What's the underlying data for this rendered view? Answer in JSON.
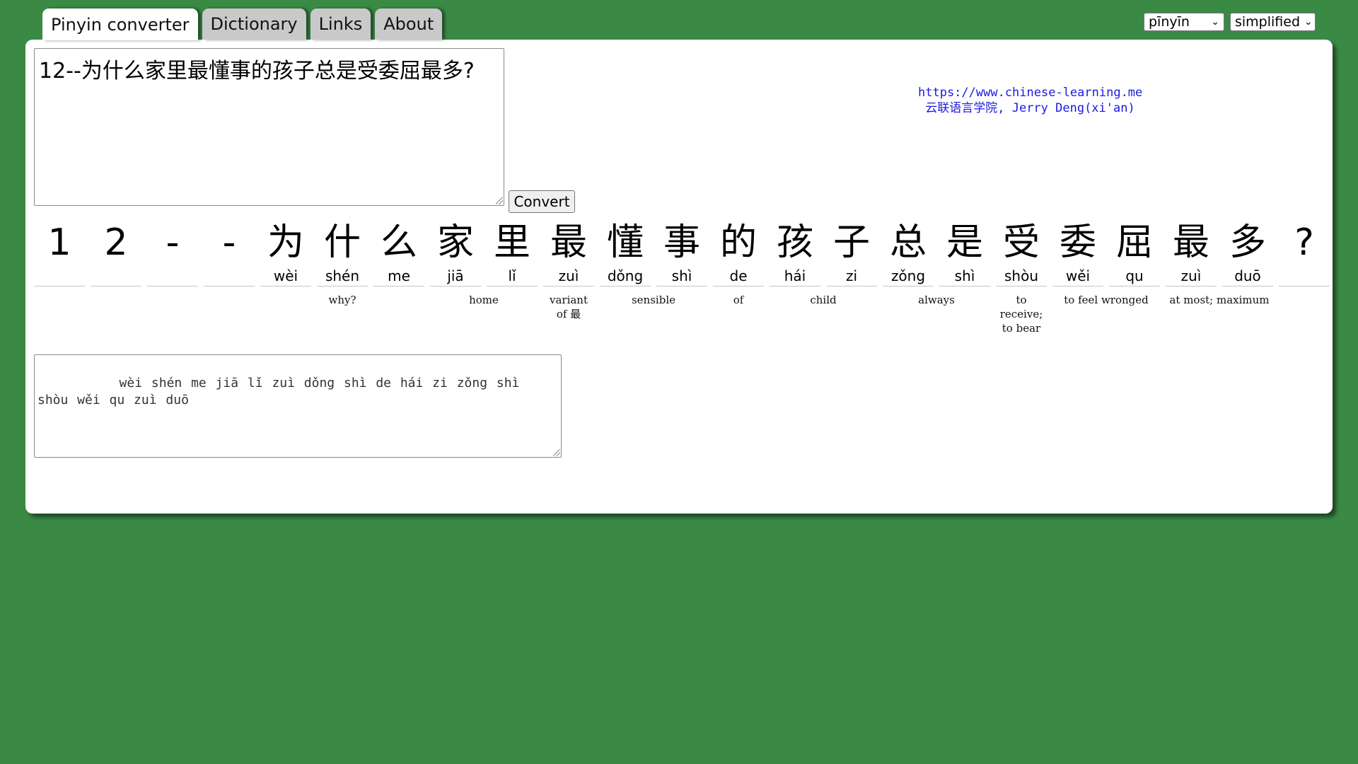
{
  "tabs": [
    {
      "label": "Pinyin converter",
      "active": true
    },
    {
      "label": "Dictionary",
      "active": false
    },
    {
      "label": "Links",
      "active": false
    },
    {
      "label": "About",
      "active": false
    }
  ],
  "selects": {
    "romanization": "pīnyīn",
    "script": "simplified"
  },
  "input": {
    "value": "12--为什么家里最懂事的孩子总是受委屈最多?"
  },
  "convert_label": "Convert",
  "credit": {
    "url": "https://www.chinese-learning.me",
    "line2": "云联语言学院, Jerry Deng(xi'an)"
  },
  "characters": [
    {
      "hz": "1",
      "py": ""
    },
    {
      "hz": "2",
      "py": ""
    },
    {
      "hz": "-",
      "py": ""
    },
    {
      "hz": "-",
      "py": ""
    },
    {
      "hz": "为",
      "py": "wèi"
    },
    {
      "hz": "什",
      "py": "shén"
    },
    {
      "hz": "么",
      "py": "me"
    },
    {
      "hz": "家",
      "py": "jiā"
    },
    {
      "hz": "里",
      "py": "lǐ"
    },
    {
      "hz": "最",
      "py": "zuì"
    },
    {
      "hz": "懂",
      "py": "dǒng"
    },
    {
      "hz": "事",
      "py": "shì"
    },
    {
      "hz": "的",
      "py": "de"
    },
    {
      "hz": "孩",
      "py": "hái"
    },
    {
      "hz": "子",
      "py": "zi"
    },
    {
      "hz": "总",
      "py": "zǒng"
    },
    {
      "hz": "是",
      "py": "shì"
    },
    {
      "hz": "受",
      "py": "shòu"
    },
    {
      "hz": "委",
      "py": "wěi"
    },
    {
      "hz": "屈",
      "py": "qu"
    },
    {
      "hz": "最",
      "py": "zuì"
    },
    {
      "hz": "多",
      "py": "duō"
    },
    {
      "hz": "?",
      "py": ""
    }
  ],
  "glosses": [
    {
      "text": "why?",
      "start": 4,
      "span": 3
    },
    {
      "text": "home",
      "start": 7,
      "span": 2
    },
    {
      "text": "variant of 最",
      "start": 9,
      "span": 1
    },
    {
      "text": "sensible",
      "start": 10,
      "span": 2
    },
    {
      "text": "of",
      "start": 12,
      "span": 1
    },
    {
      "text": "child",
      "start": 13,
      "span": 2
    },
    {
      "text": "always",
      "start": 15,
      "span": 2
    },
    {
      "text": "to receive; to bear",
      "start": 17,
      "span": 1
    },
    {
      "text": "to feel wronged",
      "start": 18,
      "span": 2
    },
    {
      "text": "at most; maximum",
      "start": 20,
      "span": 2
    }
  ],
  "output": {
    "value": "   wèi shén me jiā lǐ zuì dǒng shì de hái zi zǒng shì shòu wěi qu zuì duō"
  }
}
